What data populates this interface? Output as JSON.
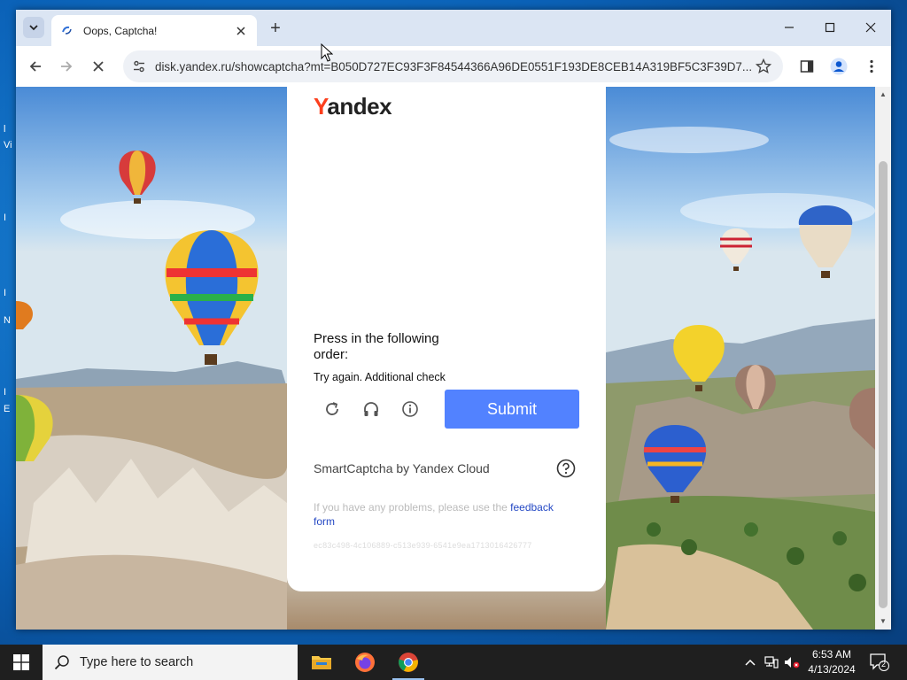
{
  "browser": {
    "tab_title": "Oops, Captcha!",
    "new_tab_symbol": "+",
    "url": "disk.yandex.ru/showcaptcha?mt=B050D727EC93F3F84544366A96DE0551F193DE8CEB14A319BF5C3F39D7...",
    "icons": {
      "tab_search": "chevron-down-icon",
      "tab_close": "close-icon",
      "back": "back-arrow-icon",
      "forward": "forward-arrow-icon",
      "reload": "stop-loading-icon",
      "site_info": "site-settings-icon",
      "bookmark": "star-icon",
      "side_panel": "side-panel-icon",
      "profile": "profile-icon",
      "menu": "more-vert-icon"
    }
  },
  "captcha": {
    "logo": {
      "first": "Y",
      "rest": "andex"
    },
    "instruction": "Press in the following order:",
    "retry_message": "Try again. Additional check",
    "submit_label": "Submit",
    "brand": "SmartCaptcha by Yandex Cloud",
    "problems_text": "If you have any problems, please use the ",
    "feedback_link": "feedback form",
    "token": "ec83c498-4c106889-c513e939-6541e9ea1713016426777",
    "controls": [
      "refresh-icon",
      "audio-icon",
      "info-icon"
    ]
  },
  "taskbar": {
    "search_placeholder": "Type here to search",
    "time": "6:53 AM",
    "date": "4/13/2024",
    "notification_count": "2",
    "apps": [
      "file-explorer-icon",
      "firefox-icon",
      "chrome-icon"
    ]
  },
  "colors": {
    "accent": "#5282ff",
    "yandex_red": "#fc3f1d",
    "tab_strip": "#dbe5f3",
    "link": "#2448c4"
  }
}
